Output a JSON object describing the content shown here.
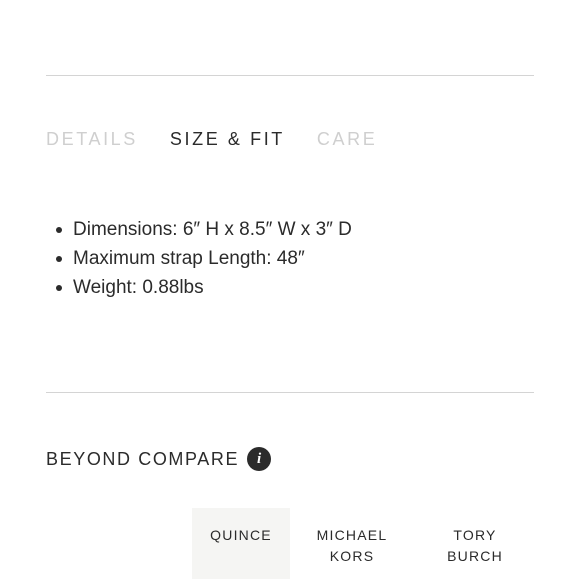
{
  "tabs": [
    {
      "label": "DETAILS",
      "active": false
    },
    {
      "label": "SIZE & FIT",
      "active": true
    },
    {
      "label": "CARE",
      "active": false
    }
  ],
  "size_fit": {
    "bullets": [
      "Dimensions: 6″ H x 8.5″ W x 3″ D",
      "Maximum strap Length: 48″",
      "Weight: 0.88lbs"
    ]
  },
  "compare": {
    "title": "BEYOND COMPARE",
    "info_icon": "info-icon",
    "columns": [
      {
        "line1": "QUINCE",
        "line2": ""
      },
      {
        "line1": "MICHAEL",
        "line2": "KORS"
      },
      {
        "line1": "TORY",
        "line2": "BURCH"
      }
    ]
  },
  "colors": {
    "text": "#2b2b2b",
    "inactive_tab": "#cfcfcf",
    "divider": "#d4d4d4",
    "highlight_column": "#f5f5f3"
  }
}
